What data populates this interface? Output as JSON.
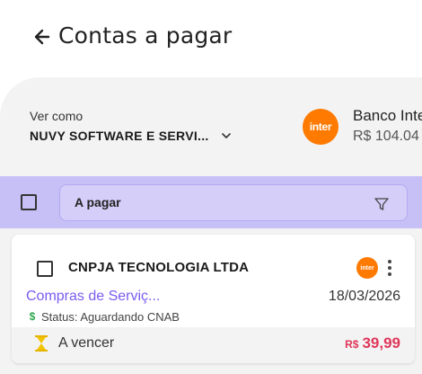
{
  "header": {
    "title": "Contas a pagar",
    "back_icon": "arrow-left-icon"
  },
  "account": {
    "label": "Ver como",
    "selected": "NUVY SOFTWARE E SERVI...",
    "dropdown_icon": "chevron-down-icon"
  },
  "bank": {
    "logo_text": "inter",
    "name": "Banco Inter",
    "balance": "R$ 104.04",
    "brand_color": "#ff7a00"
  },
  "filter": {
    "status_label": "A pagar",
    "filter_icon": "funnel-icon",
    "bar_color": "#c7c0f6"
  },
  "bills": [
    {
      "supplier": "CNPJA TECNOLOGIA LTDA",
      "category": "Compras de Serviç...",
      "due_date": "18/03/2026",
      "status_text": "Status: Aguardando CNAB",
      "status_icon": "dollar-icon",
      "due_status": "A vencer",
      "due_status_icon": "hourglass-icon",
      "currency": "R$",
      "amount": "39,99",
      "bank_icon_text": "inter",
      "amount_color": "#e0365a"
    }
  ]
}
